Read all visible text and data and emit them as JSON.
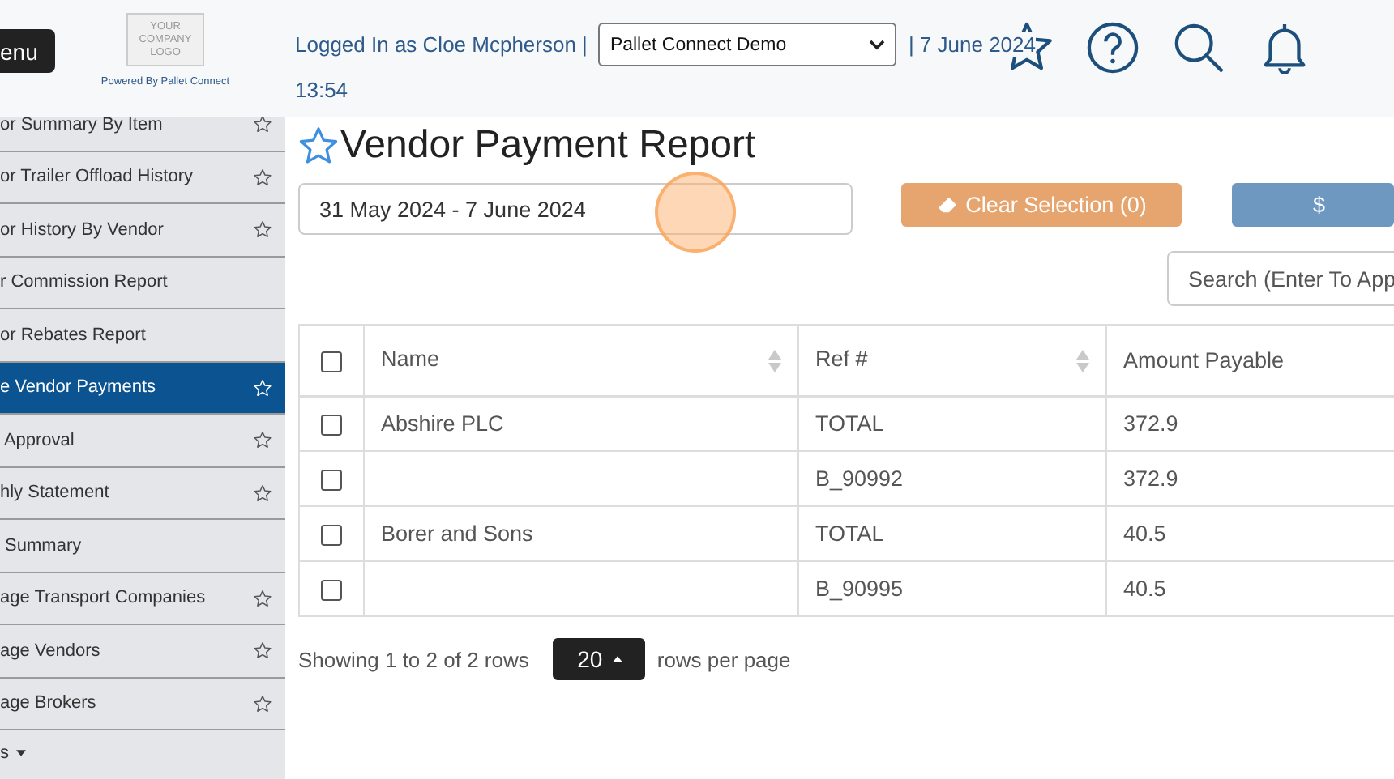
{
  "header": {
    "menu_button": "enu",
    "logo": {
      "lines": [
        "YOUR",
        "COMPANY",
        "LOGO"
      ],
      "caption": "Powered By Pallet Connect"
    },
    "user_text": "Logged In as Cloe Mcpherson |",
    "company_select": "Pallet Connect Demo",
    "date": "| 7 June 2024",
    "time": "13:54"
  },
  "sidebar": {
    "items": [
      {
        "label": "or Summary By Item",
        "star": true,
        "selected": false
      },
      {
        "label": "or Trailer Offload History",
        "star": true,
        "selected": false
      },
      {
        "label": "or History By Vendor",
        "star": true,
        "selected": false
      },
      {
        "label": "r Commission Report",
        "star": false,
        "selected": false
      },
      {
        "label": "or Rebates Report",
        "star": false,
        "selected": false
      },
      {
        "label": "e Vendor Payments",
        "star": true,
        "selected": true
      },
      {
        "label": " Approval",
        "star": true,
        "selected": false
      },
      {
        "label": "hly Statement",
        "star": true,
        "selected": false
      },
      {
        "label": " Summary",
        "star": false,
        "selected": false
      },
      {
        "label": "age Transport Companies",
        "star": true,
        "selected": false
      },
      {
        "label": "age Vendors",
        "star": true,
        "selected": false
      },
      {
        "label": "age Brokers",
        "star": true,
        "selected": false
      }
    ],
    "footer": "s"
  },
  "page": {
    "title": "Vendor Payment Report",
    "date_range": "31 May 2024 - 7 June 2024",
    "buttons": [
      {
        "label": "Clear Selection (0)",
        "kind": "clear"
      },
      {
        "label": "$",
        "kind": "primary"
      }
    ],
    "search": {
      "placeholder": "Search (Enter To App"
    },
    "table": {
      "select_all": {
        "checked": false
      },
      "columns": [
        {
          "label": "Name",
          "sortable": true
        },
        {
          "label": "Ref #",
          "sortable": true
        },
        {
          "label": "Amount Payable",
          "sortable": false
        }
      ],
      "rows": [
        {
          "checked": false,
          "name": "Abshire PLC",
          "ref": "TOTAL",
          "amount": "372.9"
        },
        {
          "checked": false,
          "ref": "B_90992",
          "amount": "372.9"
        },
        {
          "checked": false,
          "name": "Borer and Sons",
          "ref": "TOTAL",
          "amount": "40.5"
        },
        {
          "checked": false,
          "ref": "B_90995",
          "amount": "40.5"
        }
      ]
    },
    "pagination": {
      "summary": "Showing 1 to 2 of 2 rows",
      "page_size": "20",
      "suffix": "rows per page"
    }
  }
}
